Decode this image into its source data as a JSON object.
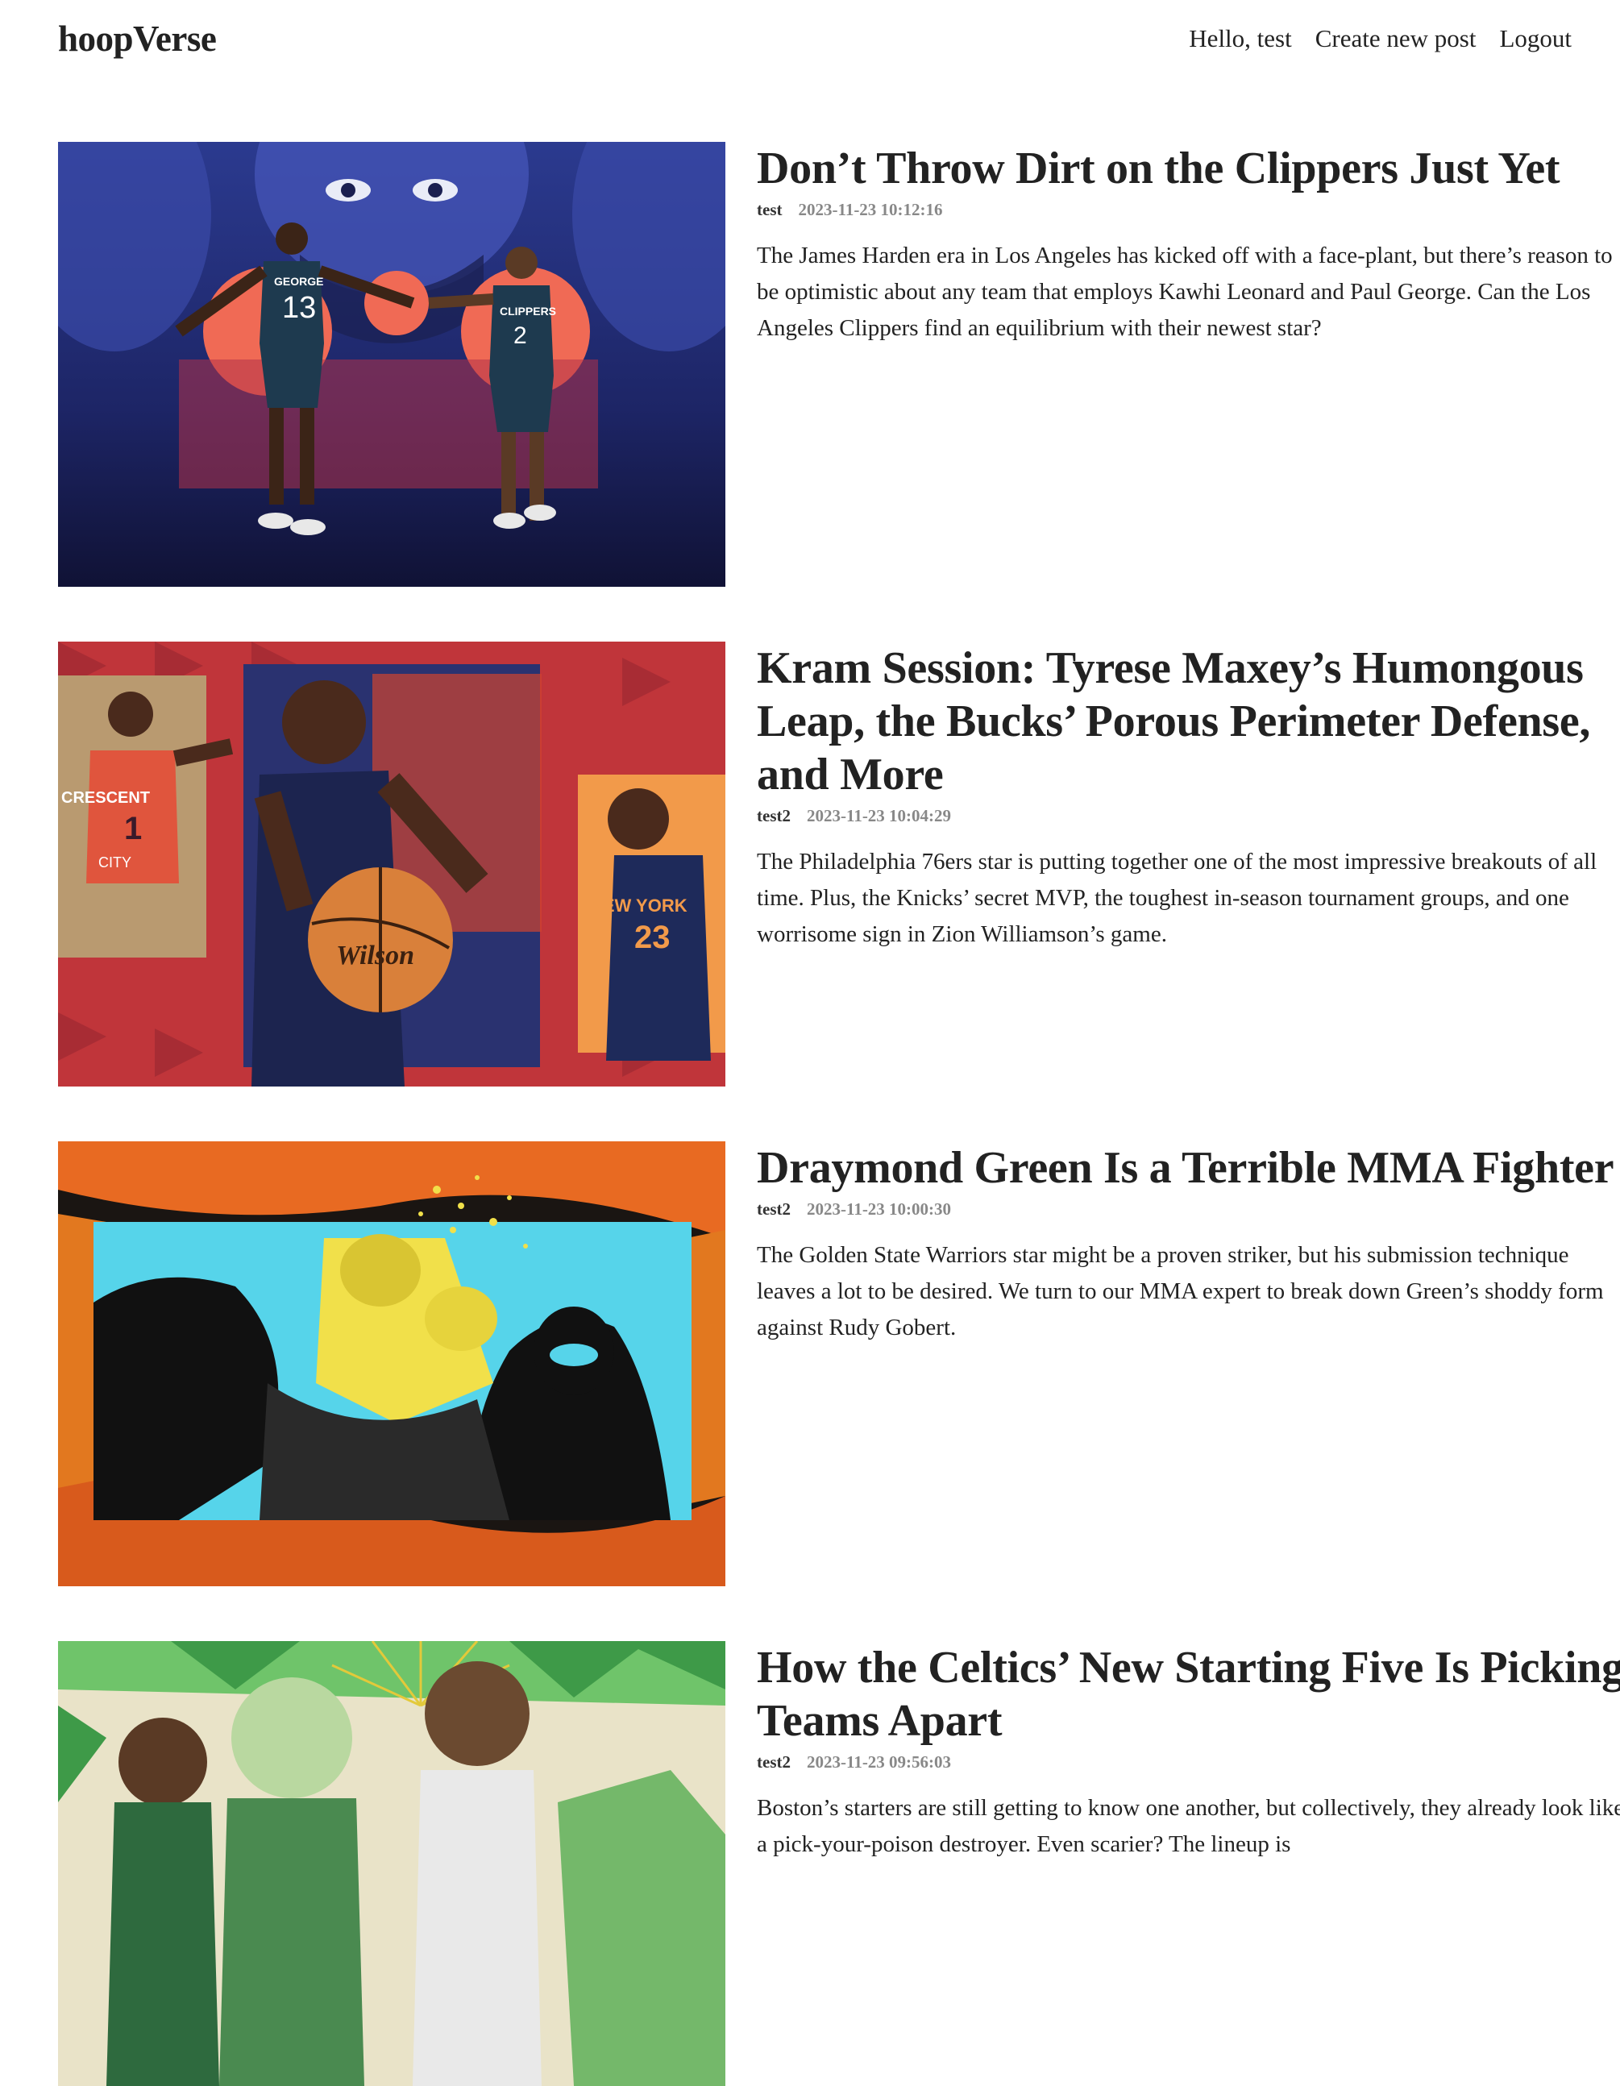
{
  "header": {
    "logo": "hoopVerse",
    "nav": {
      "greeting": "Hello, test",
      "create": "Create new post",
      "logout": "Logout"
    }
  },
  "posts": [
    {
      "title": "Don’t Throw Dirt on the Clippers Just Yet",
      "author": "test",
      "time": "2023-11-23 10:12:16",
      "summary": "The James Harden era in Los Angeles has kicked off with a face-plant, but there’s reason to be optimistic about any team that employs Kawhi Leonard and Paul George. Can the Los Angeles Clippers find an equilibrium with their newest star?",
      "image_text": [
        "GEORGE",
        "13",
        "CLIPPERS",
        "2"
      ]
    },
    {
      "title": "Kram Session: Tyrese Maxey’s Humongous Leap, the Bucks’ Porous Perimeter Defense, and More",
      "author": "test2",
      "time": "2023-11-23 10:04:29",
      "summary": "The Philadelphia 76ers star is putting together one of the most impressive breakouts of all time. Plus, the Knicks’ secret MVP, the toughest in-season tournament groups, and one worrisome sign in Zion Williamson’s game.",
      "image_text": [
        "CRESCENT",
        "1",
        "CITY",
        "NEW YORK",
        "23",
        "Wilson"
      ]
    },
    {
      "title": "Draymond Green Is a Terrible MMA Fighter",
      "author": "test2",
      "time": "2023-11-23 10:00:30",
      "summary": "The Golden State Warriors star might be a proven striker, but his submission technique leaves a lot to be desired. We turn to our MMA expert to break down Green’s shoddy form against Rudy Gobert.",
      "image_text": []
    },
    {
      "title": "How the Celtics’ New Starting Five Is Picking Teams Apart",
      "author": "test2",
      "time": "2023-11-23 09:56:03",
      "summary": "Boston’s starters are still getting to know one another, but collectively, they already look like a pick-your-poison destroyer. Even scarier? The lineup is",
      "image_text": []
    }
  ]
}
